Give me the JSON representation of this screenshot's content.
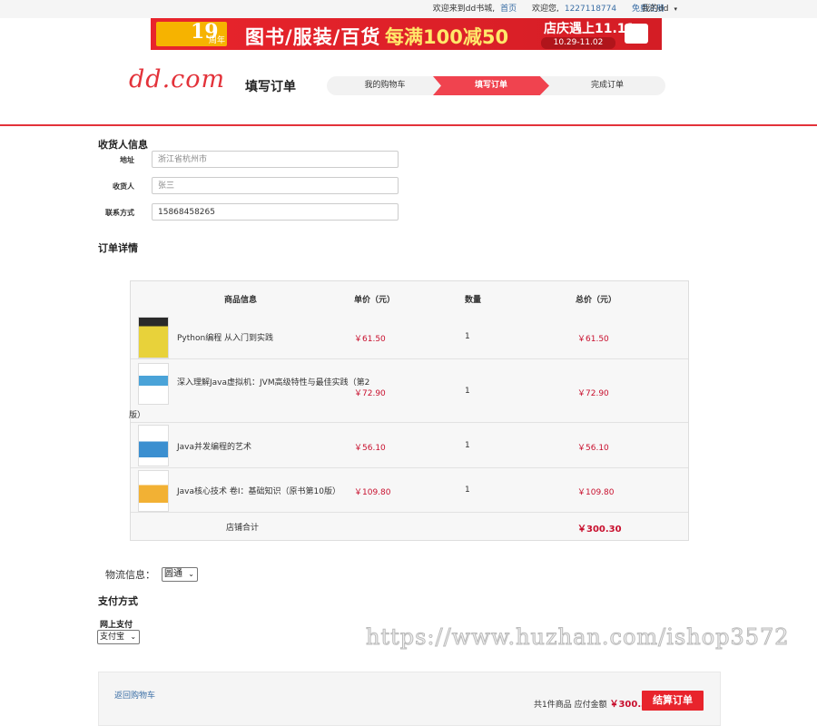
{
  "topbar": {
    "welcome": "欢迎来到dd书城,",
    "home_link": "首页",
    "greeting": "欢迎您,",
    "user_phone": "1227118774",
    "register_link": "免费注册",
    "my_dd": "我的dd"
  },
  "banner": {
    "anniversary_number": "19",
    "anniversary_label": "周年",
    "categories": "图书/服装/百货",
    "offer": "每满100减50",
    "sale_title": "店庆遇上11.11",
    "sale_dates": "10.29-11.02"
  },
  "header": {
    "logo": "dd.com",
    "page_title": "填写订单",
    "steps": [
      "我的购物车",
      "填写订单",
      "完成订单"
    ],
    "active_step": 1
  },
  "receiver": {
    "section_title": "收货人信息",
    "address_label": "地址",
    "address_placeholder": "浙江省杭州市",
    "name_label": "收货人",
    "name_placeholder": "张三",
    "phone_label": "联系方式",
    "phone_value": "15868458265"
  },
  "order": {
    "section_title": "订单详情",
    "columns": [
      "商品信息",
      "单价（元）",
      "数量",
      "总价（元）"
    ],
    "items": [
      {
        "name": "Python编程 从入门到实践",
        "price": "￥61.50",
        "qty": "1",
        "total": "￥61.50"
      },
      {
        "name": "深入理解Java虚拟机：JVM高级特性与最佳实践（第2",
        "name_wrap": "版）",
        "price": "￥72.90",
        "qty": "1",
        "total": "￥72.90"
      },
      {
        "name": "Java并发编程的艺术",
        "price": "￥56.10",
        "qty": "1",
        "total": "￥56.10"
      },
      {
        "name": "Java核心技术 卷I：基础知识（原书第10版）",
        "price": "￥109.80",
        "qty": "1",
        "total": "￥109.80"
      }
    ],
    "subtotal_label": "店铺合计",
    "subtotal_value": "￥300.30"
  },
  "shipping": {
    "label": "物流信息：",
    "selected": "圆通"
  },
  "payment": {
    "section_title": "支付方式",
    "online_label": "网上支付",
    "selected": "支付宝"
  },
  "footer": {
    "back_link": "返回购物车",
    "summary_text": "共1件商品 应付金额",
    "amount": "￥300.30",
    "checkout_button": "结算订单"
  },
  "watermark": "https://www.huzhan.com/ishop3572",
  "colors": {
    "accent": "#e3323a",
    "price": "#c8102e",
    "link": "#3a6ea5"
  }
}
